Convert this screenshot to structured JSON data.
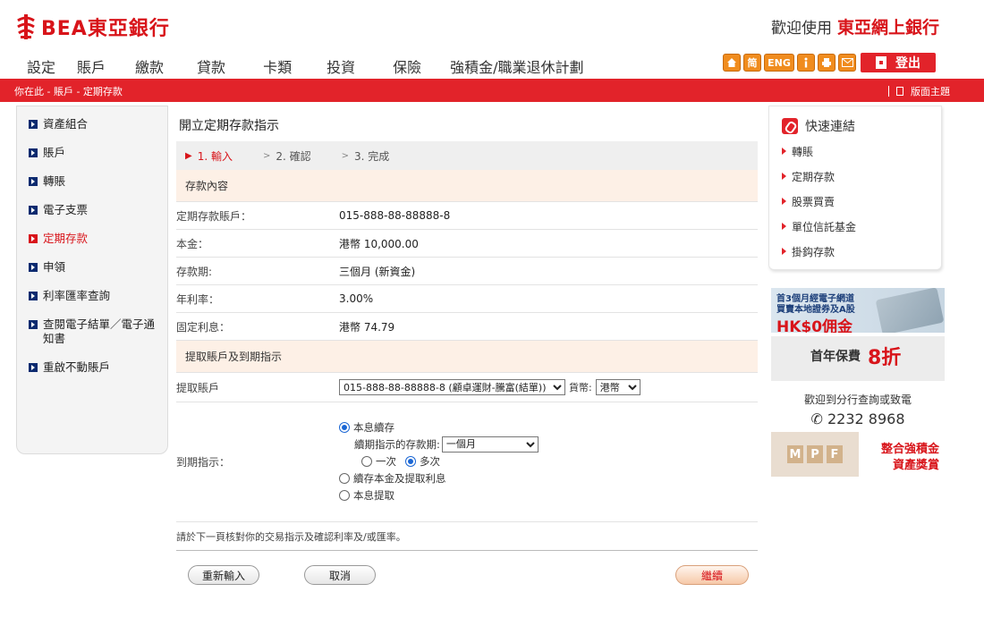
{
  "brand": {
    "name": "BEA東亞銀行",
    "welcome": "歡迎使用",
    "welcome_brand": "東亞網上銀行"
  },
  "main_nav": [
    "設定",
    "賬戶",
    "繳款",
    "貸款",
    "卡類",
    "投資",
    "保險",
    "強積金/職業退休計劃"
  ],
  "toolbar": {
    "lang_simplified": "简",
    "lang_english": "ENG",
    "logout_label": "登出"
  },
  "breadcrumb": {
    "text": "你在此 - 賬戶 - 定期存款",
    "theme_label": "版面主題"
  },
  "sidebar": {
    "items": [
      {
        "label": "資產組合",
        "active": false
      },
      {
        "label": "賬戶",
        "active": false
      },
      {
        "label": "轉賬",
        "active": false
      },
      {
        "label": "電子支票",
        "active": false
      },
      {
        "label": "定期存款",
        "active": true
      },
      {
        "label": "申領",
        "active": false
      },
      {
        "label": "利率匯率查詢",
        "active": false
      },
      {
        "label": "查閱電子結單／電子通知書",
        "active": false
      },
      {
        "label": "重啟不動賬戶",
        "active": false
      }
    ]
  },
  "form": {
    "title": "開立定期存款指示",
    "steps": [
      {
        "label": "1. 輸入",
        "current": true
      },
      {
        "label": "2. 確認",
        "current": false
      },
      {
        "label": "3. 完成",
        "current": false
      }
    ],
    "deposit_section": "存款內容",
    "deposit_rows": [
      {
        "label": "定期存款賬戶：",
        "value": "015-888-88-88888-8"
      },
      {
        "label": "本金：",
        "value": "港幣 10,000.00"
      },
      {
        "label": "存款期:",
        "value": "三個月 (新資金)"
      },
      {
        "label": "年利率：",
        "value": "3.00%"
      },
      {
        "label": "固定利息：",
        "value": "港幣 74.79"
      }
    ],
    "withdraw_section": "提取賬戶及到期指示",
    "withdraw_account": {
      "label": "提取賬戶",
      "value": "015-888-88-88888-8 (顧卓運財-騰富(結單))",
      "currency_label": "貨幣:",
      "currency_value": "港幣"
    },
    "maturity": {
      "label": "到期指示：",
      "opt_renew": "本息續存",
      "renew_period_label": "續期指示的存款期:",
      "renew_period_value": "一個月",
      "once_label": "一次",
      "multi_label": "多次",
      "opt_renew_principal": "續存本金及提取利息",
      "opt_withdraw": "本息提取"
    },
    "note": "請於下一頁核對你的交易指示及確認利率及/或匯率。",
    "buttons": {
      "reset": "重新輸入",
      "cancel": "取消",
      "continue": "繼續"
    }
  },
  "quick_links": {
    "title": "快速連結",
    "items": [
      "轉賬",
      "定期存款",
      "股票買賣",
      "單位信託基金",
      "掛鈎存款"
    ]
  },
  "ads": {
    "ad1_line1": "首3個月經電子網道",
    "ad1_line2": "買賣本地證券及A股",
    "ad1_big": "HK$0佣金",
    "ad2_text": "首年保費",
    "ad2_big": "8折",
    "contact_text": "歡迎到分行查詢或致電",
    "contact_phone": "2232 8968",
    "ad3_blocks": [
      "M",
      "P",
      "F"
    ],
    "ad3_line1": "整合強積金",
    "ad3_line2": "資產獎賞"
  },
  "colors": {
    "brand_red": "#e2232a",
    "navy": "#0b2a6f",
    "toolbar_orange": "#f08c1e"
  }
}
